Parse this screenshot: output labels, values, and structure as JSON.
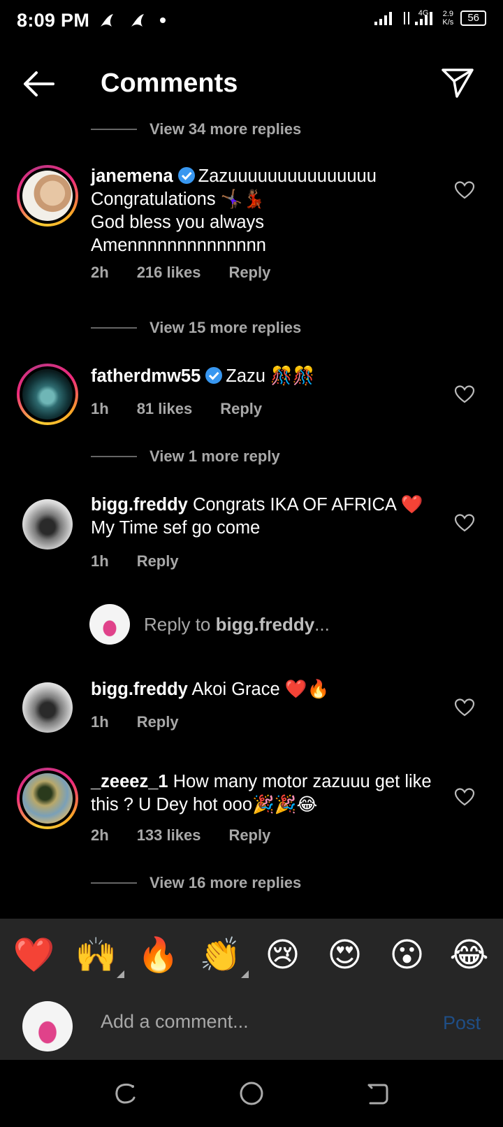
{
  "status_bar": {
    "time": "8:09 PM",
    "net_speed_value": "2.9",
    "net_speed_unit": "K/s",
    "network": "4G",
    "battery": "56"
  },
  "header": {
    "title": "Comments"
  },
  "view_more": [
    "View 34 more replies",
    "View 15 more replies",
    "View 1 more reply",
    "View 16 more replies"
  ],
  "comments": [
    {
      "username": "janemena",
      "verified": true,
      "lines": [
        "Zazuuuuuuuuuuuuuuu",
        "Congratulations 🤸🏾‍♀️💃🏾",
        "God bless you always",
        "Amennnnnnnnnnnnnn"
      ],
      "time": "2h",
      "likes": "216 likes",
      "reply": "Reply"
    },
    {
      "username": "fatherdmw55",
      "verified": true,
      "text": "Zazu 🎊🎊",
      "time": "1h",
      "likes": "81 likes",
      "reply": "Reply"
    },
    {
      "username": "bigg.freddy",
      "verified": false,
      "text": "Congrats IKA OF AFRICA ❤️ My Time sef go come",
      "time": "1h",
      "reply": "Reply"
    },
    {
      "username": "bigg.freddy",
      "verified": false,
      "text": "Akoi Grace ❤️🔥",
      "time": "1h",
      "reply": "Reply"
    },
    {
      "username": "_zeeez_1",
      "verified": false,
      "text": "How many motor zazuuu get like this ? U Dey hot ooo🎉🎉😂",
      "time": "2h",
      "likes": "133 likes",
      "reply": "Reply"
    }
  ],
  "reply_prompt": {
    "prefix": "Reply to ",
    "user": "bigg.freddy",
    "suffix": "..."
  },
  "emoji_bar": [
    "❤️",
    "🙌",
    "🔥",
    "👏",
    "😢",
    "😍",
    "😮",
    "😂"
  ],
  "compose": {
    "placeholder": "Add a comment...",
    "post_label": "Post"
  },
  "colors": {
    "background": "#000000",
    "panel": "#262626",
    "secondary_text": "#a8a8a8",
    "verified": "#3897f0",
    "post_disabled": "#1f4e86"
  }
}
